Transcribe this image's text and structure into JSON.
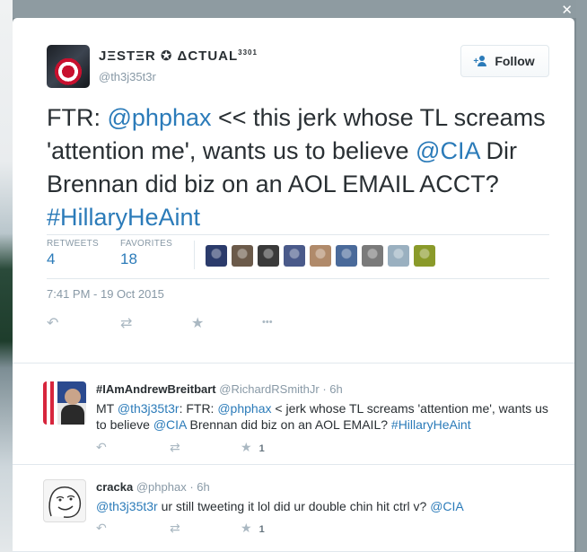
{
  "main_tweet": {
    "fullname": "JΞSTΞR ✪ ΔCTUAL",
    "fullname_sup": "3301",
    "username": "@th3j35t3r",
    "follow_label": "Follow",
    "text_parts": [
      "FTR: ",
      "@phphax",
      " << this jerk whose TL screams 'attention me', wants us to believe ",
      "@CIA",
      " Dir Brennan did biz on an AOL EMAIL ACCT? ",
      "#HillaryHeAint"
    ],
    "retweets_label": "RETWEETS",
    "retweets_count": "4",
    "favorites_label": "FAVORITES",
    "favorites_count": "18",
    "timestamp": "7:41 PM - 19 Oct 2015",
    "favoriter_colors": [
      "#2b3b6b",
      "#6b5a4a",
      "#3a3a3a",
      "#4a5a8a",
      "#b08a6a",
      "#4a6a9a",
      "#7a7a7a",
      "#9ab0c0",
      "#8a9a2a"
    ]
  },
  "icons": {
    "reply": "↶",
    "retweet": "⇄",
    "favorite": "★",
    "more": "•••",
    "close": "✕"
  },
  "replies": [
    {
      "name": "#IAmAndrewBreitbart",
      "username": "@RichardRSmithJr",
      "time": "· 6h",
      "text_parts": [
        "MT ",
        "@th3j35t3r",
        ": FTR: ",
        "@phphax",
        " < jerk whose TL screams 'attention me', wants us to believe ",
        "@CIA",
        " Brennan did biz on an AOL EMAIL? ",
        "#HillaryHeAint"
      ],
      "favorite_count": "1"
    },
    {
      "name": "cracka",
      "username": "@phphax",
      "time": "· 6h",
      "text_parts": [
        "@th3j35t3r",
        " ur still tweeting it lol did ur double chin hit ctrl v? ",
        "@CIA"
      ],
      "favorite_count": "1"
    }
  ]
}
